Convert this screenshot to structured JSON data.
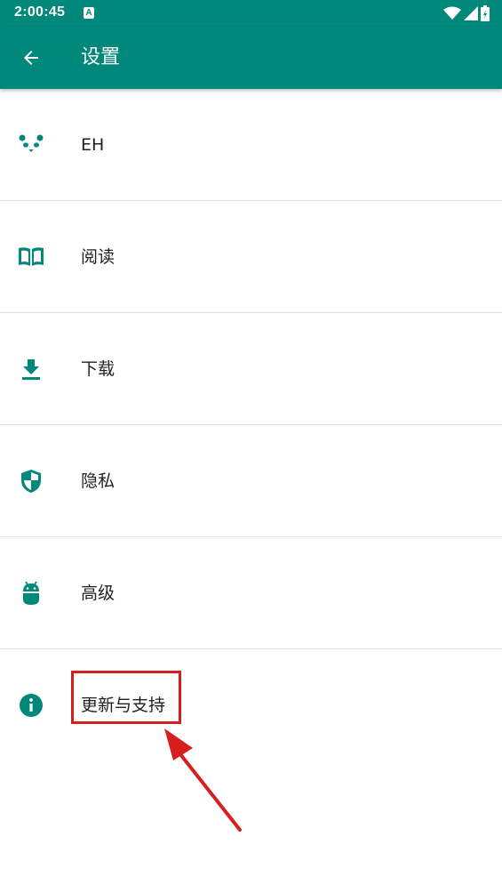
{
  "status_bar": {
    "time": "2:00:45",
    "notification_badge": "A",
    "icons": [
      "wifi-icon",
      "signal-icon",
      "battery-charging-icon"
    ]
  },
  "app_bar": {
    "title": "设置",
    "back_icon": "arrow-back-icon",
    "background": "#00897b"
  },
  "settings": {
    "items": [
      {
        "label": "EH",
        "icon": "panda-icon"
      },
      {
        "label": "阅读",
        "icon": "book-icon"
      },
      {
        "label": "下载",
        "icon": "download-icon"
      },
      {
        "label": "隐私",
        "icon": "shield-icon"
      },
      {
        "label": "高级",
        "icon": "android-icon"
      },
      {
        "label": "更新与支持",
        "icon": "info-icon"
      }
    ]
  },
  "annotation": {
    "highlight_color": "#d81e1e",
    "target": "更新与支持"
  },
  "colors": {
    "accent": "#00897b",
    "icon": "#00897b",
    "text": "#212121",
    "divider": "#e0e0e0"
  }
}
